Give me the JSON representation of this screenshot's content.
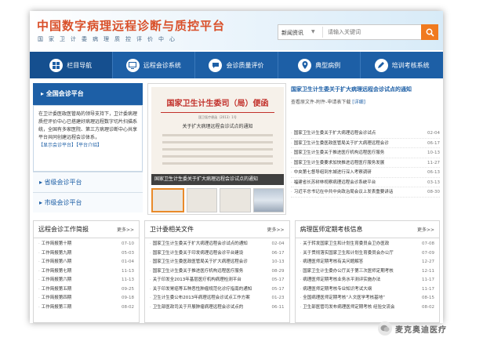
{
  "header": {
    "title": "中国数字病理远程诊断与质控平台",
    "subtitle": "国家卫计委病理质控评价中心",
    "search": {
      "category": "新闻资讯",
      "placeholder": "请输入关键词"
    }
  },
  "nav": {
    "items": [
      {
        "label": "栏目导航",
        "icon": "grid-icon"
      },
      {
        "label": "远程会诊系统",
        "icon": "screen-icon"
      },
      {
        "label": "会诊质量评价",
        "icon": "chat-icon"
      },
      {
        "label": "典型病例",
        "icon": "pin-icon"
      },
      {
        "label": "培训考核系统",
        "icon": "pencil-icon"
      }
    ]
  },
  "sidebar": {
    "header": "全国会诊平台",
    "body": "在卫计委医政医管局的领导支持下，卫计委病理质控评价中心已搭建好病理远程数字切片扫描系统，全国有多家医院、第三方病理诊断中心共享平台共同创建远程会诊体系，",
    "links": [
      "【显示会诊平台】",
      "【平台介绍】"
    ],
    "items": [
      "省级会诊平台",
      "市级会诊平台"
    ]
  },
  "center": {
    "doc_heading": "国家卫生计生委司（局）便函",
    "doc_number": "国卫医疗便函〔2013〕1号",
    "doc_subject": "关于扩大病理远程会诊试点的通知",
    "caption": "国家卫生计生委关于扩大病理远程会诊试点的通知"
  },
  "news": {
    "title": "国家卫生计生委关于扩大病理远程会诊试点的通知",
    "desc": "查看原文件-附件-申请表下载",
    "more": "[详细]",
    "items": [
      {
        "title": "国家卫生计生委关于扩大病理远程会诊试点",
        "date": "02-04"
      },
      {
        "title": "国家卫生计生委医政医管局关于扩大病理远程会诊",
        "date": "06-17"
      },
      {
        "title": "国家卫生计生委关于推进医疗机构远程医疗服务",
        "date": "10-13"
      },
      {
        "title": "国家卫生计生委要求加快推进远程医疗服务发展",
        "date": "11-27"
      },
      {
        "title": "中央第七督导组到东城进行深入考察调研",
        "date": "06-13"
      },
      {
        "title": "福建省长苏树林视察病理远程会诊系统平台",
        "date": "03-13"
      },
      {
        "title": "习近平总书记在中共中央政治局会议上发表重要讲话",
        "date": "08-30"
      }
    ]
  },
  "columns": [
    {
      "title": "远程会诊工作简报",
      "more": "更多>>",
      "rows": [
        {
          "title": "工作简报第十期",
          "date": "07-10"
        },
        {
          "title": "工作简报第九期",
          "date": "05-03"
        },
        {
          "title": "工作简报第八期",
          "date": "01-04"
        },
        {
          "title": "工作简报第七期",
          "date": "11-13"
        },
        {
          "title": "工作简报第六期",
          "date": "11-13"
        },
        {
          "title": "工作简报第五期",
          "date": "09-25"
        },
        {
          "title": "工作简报第四期",
          "date": "09-18"
        },
        {
          "title": "工作简报第三期",
          "date": "08-02"
        }
      ]
    },
    {
      "title": "卫计委相关文件",
      "more": "更多>>",
      "rows": [
        {
          "title": "国家卫生计生委关于扩大病理远程会诊试点的通知",
          "date": "02-04"
        },
        {
          "title": "国家卫生计生委关于印发病理远程会诊平台建设",
          "date": "06-17"
        },
        {
          "title": "国家卫生计生委医政医管局关于扩大病理远程会诊",
          "date": "10-13"
        },
        {
          "title": "国家卫生计生委关于推进医疗机构远程医疗服务",
          "date": "08-29"
        },
        {
          "title": "关于印发全2013年基层医疗机构病理检测平台",
          "date": "05-17"
        },
        {
          "title": "关于印发胃癌等五种恶性肿瘤规范化诊疗指南的通知",
          "date": "05-17"
        },
        {
          "title": "卫生计生委公布2013年病理远程会诊试点工作方案",
          "date": "01-23"
        },
        {
          "title": "卫生部医政司关于开展肿瘤病理远程会诊试点的",
          "date": "06-11"
        }
      ]
    },
    {
      "title": "病理医师定期考核信息",
      "more": "更多>>",
      "rows": [
        {
          "title": "关于转发国家卫生和计划生育委员会卫办医政",
          "date": "07-08"
        },
        {
          "title": "关于贯彻落实国家卫生和计划生育委员会办公厅",
          "date": "07-09"
        },
        {
          "title": "病理医师定期考核有关问题解答",
          "date": "12-27"
        },
        {
          "title": "国家卫生计生委办公厅关于第三次医师定期考核",
          "date": "12-11"
        },
        {
          "title": "病理医师定期考核业务水平测评实施办法",
          "date": "11-17"
        },
        {
          "title": "病理医师定期考核专业知识考试大纲",
          "date": "11-17"
        },
        {
          "title": "全国病理医师定期考核“人文医学考核基地”",
          "date": "08-15"
        },
        {
          "title": "卫生部医管司发布病理医师定期考核 经验交流会",
          "date": "08-02"
        }
      ]
    }
  ],
  "watermark": {
    "text": "麦克奥迪医疗"
  }
}
